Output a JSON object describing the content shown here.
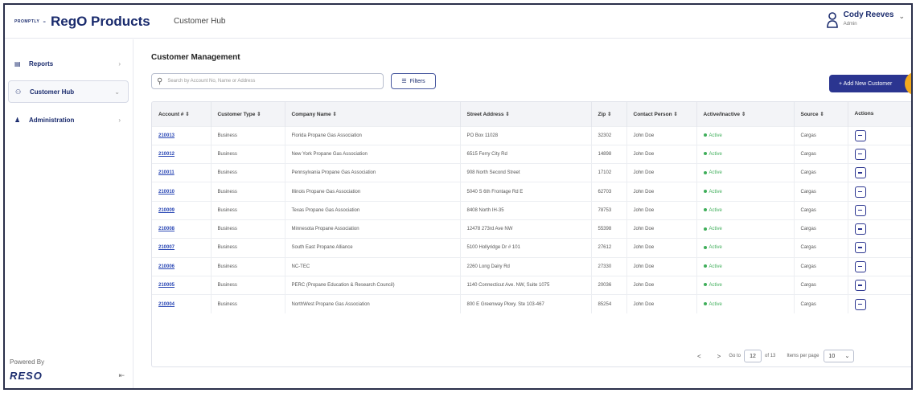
{
  "header": {
    "brand_mark": "PROMPTLY",
    "brand_name": "RegO Products",
    "breadcrumb": "Customer Hub",
    "user_name": "Cody Reeves",
    "user_role": "Admin"
  },
  "sidebar": {
    "items": [
      {
        "label": "Reports",
        "icon": "document-icon"
      },
      {
        "label": "Customer Hub",
        "icon": "people-icon"
      },
      {
        "label": "Administration",
        "icon": "person-icon"
      }
    ],
    "powered_by": "Powered By",
    "powered_logo": "RESO"
  },
  "main": {
    "title": "Customer Management",
    "search_placeholder": "Search by Account No, Name or Address",
    "filters_label": "Filters",
    "add_button_label": "+ Add New Customer"
  },
  "table": {
    "columns": [
      "Account # ⇕",
      "Customer Type ⇕",
      "Company Name ⇕",
      "Street Address ⇕",
      "Zip ⇕",
      "Contact Person ⇕",
      "Active/Inactive ⇕",
      "Source ⇕",
      "Actions"
    ],
    "rows": [
      {
        "account": "210013",
        "type": "Business",
        "company": "Florida Propane Gas Association",
        "address": "PO Box 11028",
        "zip": "32302",
        "contact": "John Doe",
        "status": "Active",
        "source": "Cargas"
      },
      {
        "account": "210012",
        "type": "Business",
        "company": "New York Propane Gas Association",
        "address": "6515 Ferry City Rd",
        "zip": "14898",
        "contact": "John Doe",
        "status": "Active",
        "source": "Cargas"
      },
      {
        "account": "210011",
        "type": "Business",
        "company": "Pennsylvania Propane Gas Association",
        "address": "908 North Second Street",
        "zip": "17102",
        "contact": "John Doe",
        "status": "Active",
        "source": "Cargas"
      },
      {
        "account": "210010",
        "type": "Business",
        "company": "Illinois Propane Gas Association",
        "address": "5040 S 6th Frontage Rd E",
        "zip": "62703",
        "contact": "John Doe",
        "status": "Active",
        "source": "Cargas"
      },
      {
        "account": "210009",
        "type": "Business",
        "company": "Texas Propane Gas Association",
        "address": "8408 North IH-35",
        "zip": "78753",
        "contact": "John Doe",
        "status": "Active",
        "source": "Cargas"
      },
      {
        "account": "210008",
        "type": "Business",
        "company": "Minnesota Propane Association",
        "address": "12478 273rd Ave NW",
        "zip": "55398",
        "contact": "John Doe",
        "status": "Active",
        "source": "Cargas"
      },
      {
        "account": "210007",
        "type": "Business",
        "company": "South East Propane Alliance",
        "address": "5100 Hollyridge Dr # 101",
        "zip": "27612",
        "contact": "John Doe",
        "status": "Active",
        "source": "Cargas"
      },
      {
        "account": "210006",
        "type": "Business",
        "company": "NC-TEC",
        "address": "2260 Long Dairy Rd",
        "zip": "27330",
        "contact": "John Doe",
        "status": "Active",
        "source": "Cargas"
      },
      {
        "account": "210005",
        "type": "Business",
        "company": "PERC (Propane Education & Research Council)",
        "address": "1140 Connecticut Ave. NW, Suite 1075",
        "zip": "20036",
        "contact": "John Doe",
        "status": "Active",
        "source": "Cargas"
      },
      {
        "account": "210004",
        "type": "Business",
        "company": "NorthWest Propane Gas Association",
        "address": "800 E Greenway Pkwy. Ste 103-467",
        "zip": "85254",
        "contact": "John Doe",
        "status": "Active",
        "source": "Cargas"
      }
    ]
  },
  "pagination": {
    "prev": "<",
    "next": ">",
    "goto_label": "Go to",
    "current_page": "12",
    "of_label": "of 13",
    "items_per_page_label": "Items per page",
    "page_size": "10"
  },
  "colors": {
    "brand": "#1a2b6d",
    "primary_button": "#2b3590",
    "active_status": "#3fae5a",
    "accent": "#f2a91e"
  }
}
